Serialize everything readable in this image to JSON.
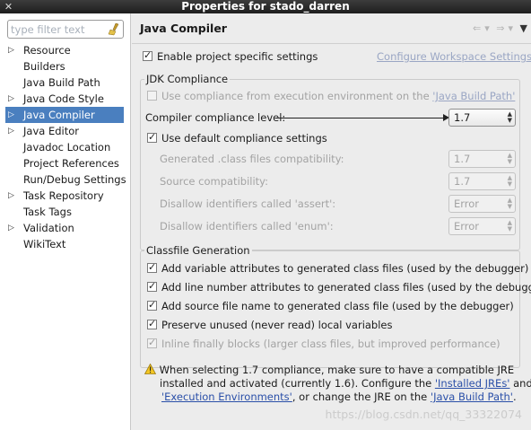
{
  "window": {
    "title": "Properties for stado_darren",
    "close_icon": "close-icon"
  },
  "filter": {
    "placeholder": "type filter text",
    "value": ""
  },
  "tree": [
    {
      "label": "Resource",
      "expandable": true
    },
    {
      "label": "Builders",
      "expandable": false
    },
    {
      "label": "Java Build Path",
      "expandable": false
    },
    {
      "label": "Java Code Style",
      "expandable": true
    },
    {
      "label": "Java Compiler",
      "expandable": true,
      "selected": true
    },
    {
      "label": "Java Editor",
      "expandable": true
    },
    {
      "label": "Javadoc Location",
      "expandable": false
    },
    {
      "label": "Project References",
      "expandable": false
    },
    {
      "label": "Run/Debug Settings",
      "expandable": false
    },
    {
      "label": "Task Repository",
      "expandable": true
    },
    {
      "label": "Task Tags",
      "expandable": false
    },
    {
      "label": "Validation",
      "expandable": true
    },
    {
      "label": "WikiText",
      "expandable": false
    }
  ],
  "page": {
    "title": "Java Compiler",
    "enable_project_settings": "Enable project specific settings",
    "configure_workspace_link": "Configure Workspace Settings...",
    "jdk": {
      "group_label": "JDK Compliance",
      "use_compliance_prefix": "Use compliance from execution environment on the ",
      "use_compliance_link": "'Java Build Path'",
      "compliance_level_label": "Compiler compliance level:",
      "compliance_level_value": "1.7",
      "use_default_label": "Use default compliance settings",
      "generated_label": "Generated .class files compatibility:",
      "generated_value": "1.7",
      "source_label": "Source compatibility:",
      "source_value": "1.7",
      "assert_label": "Disallow identifiers called 'assert':",
      "assert_value": "Error",
      "enum_label": "Disallow identifiers called 'enum':",
      "enum_value": "Error"
    },
    "classfile": {
      "group_label": "Classfile Generation",
      "opt1": "Add variable attributes to generated class files (used by the debugger)",
      "opt2": "Add line number attributes to generated class files (used by the debugger)",
      "opt3": "Add source file name to generated class file (used by the debugger)",
      "opt4": "Preserve unused (never read) local variables",
      "opt5": "Inline finally blocks (larger class files, but improved performance)"
    },
    "warning": {
      "line1": "When selecting 1.7 compliance, make sure to have a compatible JRE",
      "line2_prefix": "installed and activated (currently 1.6). Configure the ",
      "installed_jres_link": "'Installed JREs'",
      "line2_suffix": " and",
      "exec_env_link": "'Execution Environments'",
      "line3_middle": ", or change the JRE on the ",
      "build_path_link": "'Java Build Path'",
      "line3_end": "."
    }
  },
  "watermark": "https://blog.csdn.net/qq_33322074"
}
